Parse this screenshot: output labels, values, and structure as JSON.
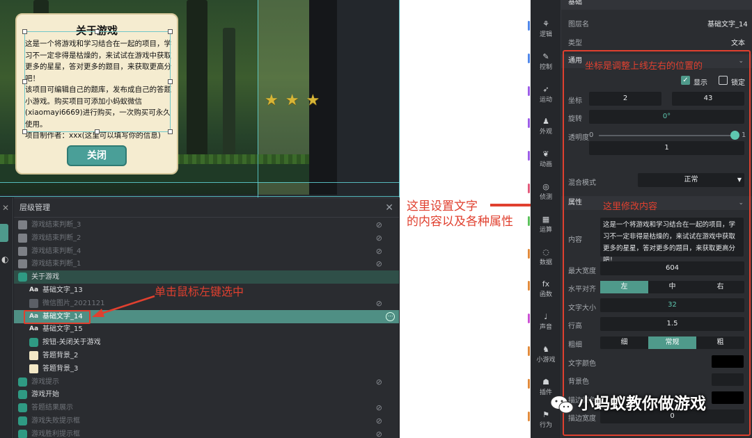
{
  "dialog": {
    "title": "关于游戏",
    "body": [
      "这是一个将游戏和学习结合在一起的项目，学习不一定非得是枯燥的，来试试在游戏中获取更多的星星，答对更多的题目，来获取更高分吧！",
      "该项目可编辑自己的题库，发布成自己的答题小游戏。购买项目可添加小蚂蚁微信(xiaomayi6669)进行购买，一次购买可永久使用。",
      "项目制作者：xxx(这里可以填写你的信息)"
    ],
    "close_label": "关闭"
  },
  "layers": {
    "title": "层级管理",
    "close": "✕",
    "rows": [
      {
        "label": "游戏结束判断_3",
        "icon": "grey",
        "indent": 0,
        "state": "dim",
        "eye": true
      },
      {
        "label": "游戏结束判断_2",
        "icon": "grey",
        "indent": 0,
        "state": "dim",
        "eye": true
      },
      {
        "label": "游戏结束判断_4",
        "icon": "grey",
        "indent": 0,
        "state": "dim",
        "eye": true
      },
      {
        "label": "游戏结束判断_1",
        "icon": "grey",
        "indent": 0,
        "state": "dim",
        "eye": true
      },
      {
        "label": "关于游戏",
        "icon": "teal",
        "indent": 0,
        "state": "group",
        "eye": false
      },
      {
        "label": "基础文字_13",
        "icon": "txt",
        "indent": 1,
        "state": "normal",
        "eye": false
      },
      {
        "label": "微信图片_2021121",
        "icon": "img",
        "indent": 1,
        "state": "dim",
        "eye": true
      },
      {
        "label": "基础文字_14",
        "icon": "txt",
        "indent": 1,
        "state": "sel",
        "eye": false
      },
      {
        "label": "基础文字_15",
        "icon": "txt",
        "indent": 1,
        "state": "normal",
        "eye": false
      },
      {
        "label": "按钮-关闭关于游戏",
        "icon": "teal",
        "indent": 1,
        "state": "normal",
        "eye": false
      },
      {
        "label": "答题背景_2",
        "icon": "cream",
        "indent": 1,
        "state": "normal",
        "eye": false
      },
      {
        "label": "答题背景_3",
        "icon": "cream",
        "indent": 1,
        "state": "normal",
        "eye": false
      },
      {
        "label": "游戏提示",
        "icon": "teal",
        "indent": 0,
        "state": "dim",
        "eye": true
      },
      {
        "label": "游戏开始",
        "icon": "teal",
        "indent": 0,
        "state": "normal",
        "eye": false
      },
      {
        "label": "答题结果展示",
        "icon": "teal",
        "indent": 0,
        "state": "dim",
        "eye": true
      },
      {
        "label": "游戏失败提示框",
        "icon": "teal",
        "indent": 0,
        "state": "dim",
        "eye": true
      },
      {
        "label": "游戏胜利提示框",
        "icon": "teal",
        "indent": 0,
        "state": "dim",
        "eye": true
      }
    ]
  },
  "annotations": {
    "click_select": "单击鼠标左键选中",
    "set_text_line1": "这里设置文字",
    "set_text_line2": "的内容以及各种属性",
    "coords": "坐标是调整上线左右的位置的",
    "edit_content": "这里修改内容"
  },
  "categories": [
    {
      "label": "逻辑",
      "color": "#4f86e8"
    },
    {
      "label": "控制",
      "color": "#4f86e8"
    },
    {
      "label": "运动",
      "color": "#9b5de5"
    },
    {
      "label": "外观",
      "color": "#9b5de5"
    },
    {
      "label": "动画",
      "color": "#9b5de5"
    },
    {
      "label": "侦测",
      "color": "#e05a7a"
    },
    {
      "label": "运算",
      "color": "#5bc05b"
    },
    {
      "label": "数据",
      "color": "#e08a3c"
    },
    {
      "label": "函数",
      "color": "#e08a3c"
    },
    {
      "label": "声音",
      "color": "#c94fd1"
    },
    {
      "label": "小游戏",
      "color": "#e08a3c"
    },
    {
      "label": "插件",
      "color": "#e08a3c"
    },
    {
      "label": "行为",
      "color": "#e08a3c"
    }
  ],
  "props": {
    "basic_section": "基础",
    "layer_name_label": "图层名",
    "layer_name": "基础文字_14",
    "type_label": "类型",
    "type_value": "文本",
    "general_section": "通用",
    "show_label": "显示",
    "lock_label": "锁定",
    "coord_label": "坐标",
    "coord_x": "2",
    "coord_y": "43",
    "rotation_label": "旋转",
    "rotation": "0°",
    "opacity_label": "透明度",
    "opacity_min": "0",
    "opacity_max": "1",
    "opacity": "1",
    "opacity_level": 1,
    "blend_label": "混合模式",
    "blend": "正常",
    "attr_section": "属性",
    "content_label": "内容",
    "content": "这是一个将游戏和学习结合在一起的项目，学习不一定非得是枯燥的，来试试在游戏中获取更多的星星，答对更多的题目，来获取更高分吧！",
    "max_width_label": "最大宽度",
    "max_width": "604",
    "halign_label": "水平对齐",
    "halign": [
      "左",
      "中",
      "右"
    ],
    "halign_selected": 0,
    "font_size_label": "文字大小",
    "font_size": "32",
    "line_height_label": "行高",
    "line_height": "1.5",
    "weight_label": "粗细",
    "weight": [
      "细",
      "常规",
      "粗"
    ],
    "weight_selected": 1,
    "text_color_label": "文字颜色",
    "text_color": "#000000",
    "bg_color_label": "背景色",
    "bg_color": "#1d1f22",
    "stroke_color_label": "描边颜色",
    "stroke_width_label": "描边宽度",
    "stroke_width": "0"
  },
  "watermark": "小蚂蚁教你做游戏",
  "colors": {
    "accent": "#4f9a8b",
    "annotation_red": "#e0402f",
    "guide_cyan": "#5fd3d7"
  }
}
